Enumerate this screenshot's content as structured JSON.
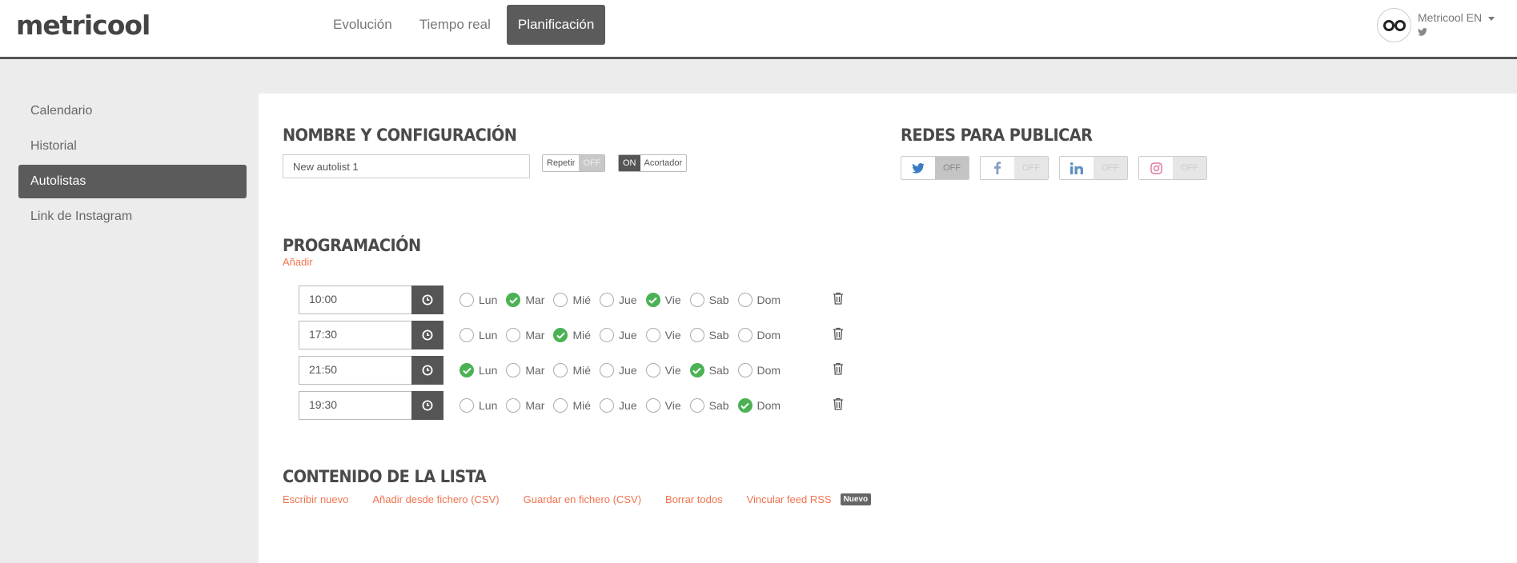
{
  "header": {
    "logo": "metricool",
    "tabs": [
      {
        "label": "Evolución"
      },
      {
        "label": "Tiempo real"
      },
      {
        "label": "Planificación",
        "active": true
      }
    ],
    "account": {
      "name": "Metricool EN",
      "network_icon": "twitter-icon"
    }
  },
  "sidebar": {
    "items": [
      {
        "label": "Calendario"
      },
      {
        "label": "Historial"
      },
      {
        "label": "Autolistas",
        "active": true
      },
      {
        "label": "Link de Instagram"
      }
    ]
  },
  "config": {
    "title": "NOMBRE Y CONFIGURACIÓN",
    "name_value": "New autolist 1",
    "repeat": {
      "label": "Repetir",
      "state": "OFF"
    },
    "shortener": {
      "label": "Acortador",
      "state": "ON"
    }
  },
  "networks": {
    "title": "REDES PARA PUBLICAR",
    "items": [
      {
        "icon": "twitter-icon",
        "state": "OFF",
        "color": "#1da1f2"
      },
      {
        "icon": "facebook-icon",
        "state": "OFF",
        "color": "#3b5998"
      },
      {
        "icon": "linkedin-icon",
        "state": "OFF",
        "color": "#0077b5"
      },
      {
        "icon": "instagram-icon",
        "state": "OFF",
        "color": "#e1306c"
      }
    ]
  },
  "schedule": {
    "title": "PROGRAMACIÓN",
    "add_label": "Añadir",
    "days": [
      "Lun",
      "Mar",
      "Mié",
      "Jue",
      "Vie",
      "Sab",
      "Dom"
    ],
    "rows": [
      {
        "time": "10:00",
        "checked": [
          false,
          true,
          false,
          false,
          true,
          false,
          false
        ]
      },
      {
        "time": "17:30",
        "checked": [
          false,
          false,
          true,
          false,
          false,
          false,
          false
        ]
      },
      {
        "time": "21:50",
        "checked": [
          true,
          false,
          false,
          false,
          false,
          true,
          false
        ]
      },
      {
        "time": "19:30",
        "checked": [
          false,
          false,
          false,
          false,
          false,
          false,
          true
        ]
      }
    ]
  },
  "content": {
    "title": "CONTENIDO DE LA LISTA",
    "links": [
      "Escribir nuevo",
      "Añadir desde fichero (CSV)",
      "Guardar en fichero (CSV)",
      "Borrar todos",
      "Vincular feed RSS"
    ],
    "badge": "Nuevo"
  },
  "colors": {
    "accent": "#f0734e",
    "check": "#4bb254",
    "dark": "#5b5b5b"
  }
}
